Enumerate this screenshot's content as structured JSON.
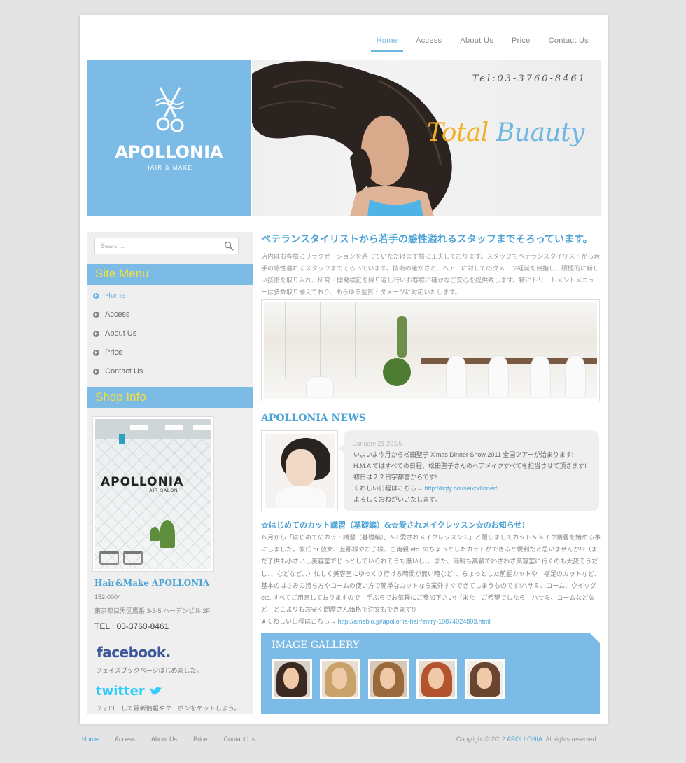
{
  "nav": {
    "items": [
      {
        "label": "Home",
        "active": true
      },
      {
        "label": "Access",
        "active": false
      },
      {
        "label": "About Us",
        "active": false
      },
      {
        "label": "Price",
        "active": false
      },
      {
        "label": "Contact Us",
        "active": false
      }
    ]
  },
  "header": {
    "logo_name": "APOLLONIA",
    "logo_sub": "HAIR & MAKE",
    "tel": "Tel:03-3760-8461",
    "tagline_1": "Total",
    "tagline_2": "Buauty"
  },
  "sidebar": {
    "search_placeholder": "Search...",
    "site_menu_title": "Site Menu",
    "menu": [
      {
        "label": "Home",
        "active": true
      },
      {
        "label": "Access",
        "active": false
      },
      {
        "label": "About Us",
        "active": false
      },
      {
        "label": "Price",
        "active": false
      },
      {
        "label": "Contact Us",
        "active": false
      }
    ],
    "shop_info_title": "Shop Info",
    "shop_sign": "APOLLONIA",
    "shop_sign_sub": "HAIR SALON",
    "shop_name": "Hair&Make APOLLONIA",
    "postal": "152-0004",
    "address": "東京都目黒区鷹番 3-3-5 ハーデンビル 2F",
    "tel": "TEL : 03-3760-8461",
    "facebook_logo": "facebook.",
    "facebook_text": "フェイスブックページはじめました。",
    "twitter_logo": "twitter",
    "twitter_text": "フォローして最新情報やクーポンをゲットしよう。"
  },
  "main": {
    "title": "ベテランスタイリストから若手の感性溢れるスタッフまでそろっています。",
    "intro": "店内はお客様にリラクゼーションを感じていただけます様に工夫しております。スタッフもベテランスタイリストから若手の感性溢れるスタッフまでそろっています。技術の確かさと、ヘアーに対してのダメージ軽減を目指し、積極的に新しい技術を取り入れ、研究・開発検証を繰り返し行いお客様に確かなご安心を提供致します。特にトリートメントメニューは多数取り揃えており、あらゆる髪質・ダメージに対応いたします。",
    "news_title": "APOLLONIA NEWS",
    "news": {
      "date": "January 21 20:35",
      "line1": "いよいよ今月から松田聖子 X'mas Dinner Show 2011 全国ツアーが始まります!",
      "line2": "H.M.A ではすべての日程、松田聖子さんのヘアメイクすべてを担当させて頂きます!",
      "line3": "初日は２２日宇都宮からです!",
      "line4_prefix": "くわしい日程はこちら→ ",
      "line4_link": "http://bqty.biz/seikodinner/",
      "line5": "よろしくおねがいいたします。"
    },
    "article_title": "☆はじめてのカット講習（基礎編）&☆愛されメイクレッスン☆のお知らせ!",
    "article_body": "６月から「はじめてのカット講習（基礎編）」&☆愛されメイクレッスン☆」と題しましてカット＆メイク講習を始める事にしました。彼氏 or 彼女、旦那様やお子様、ご両親 etc. のちょっとしたカットができると便利だと思いませんか!?（まだ子供も小さいし美容室でじっとしていられそうも無いし、、また、両親も高齢でわざわざ美容室に行くのも大変そうだし、、などなど、、）忙しく美容室にゆっくり行ける時間が無い時など、、ちょっとした前髪カットや　襟足のカットなど、基本のはさみの持ち方やコームの使い方で簡単なカットなら案外すぐできてしまうものです!ハサミ、コーム、ウイッグ etc. すべてご用意しておりますので　手ぶらでお気軽にご参加下さい!（また　ご希望でしたら　ハサミ、コームなどなど　どこよりもお安く問屋さん価格で注文もできます!）",
    "article_link_prefix": "★くわしい日程はこちら→ ",
    "article_link": "http://ameblo.jp/apollonia-hair/entry-10874024803.html",
    "gallery_title": "IMAGE GALLERY"
  },
  "footer": {
    "nav": [
      {
        "label": "Home",
        "active": true
      },
      {
        "label": "Access",
        "active": false
      },
      {
        "label": "About Us",
        "active": false
      },
      {
        "label": "Price",
        "active": false
      },
      {
        "label": "Contact Us",
        "active": false
      }
    ],
    "copyright_prefix": "Copyright © 2012 ",
    "copyright_brand": "APOLLONIA",
    "copyright_suffix": ". All rights reserved."
  },
  "colors": {
    "accent": "#7bbbe6",
    "link": "#4ca3d6",
    "menu_heading": "#f3e03d",
    "tagline_orange": "#f3b024"
  }
}
